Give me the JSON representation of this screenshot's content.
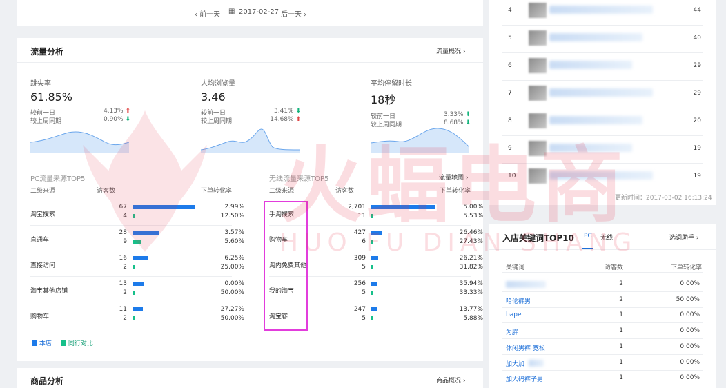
{
  "date_nav": {
    "prev": "前一天",
    "date": "2017-02-27",
    "next": "后一天"
  },
  "traffic": {
    "title": "流量分析",
    "overview_link": "流量概况",
    "metrics": [
      {
        "label": "跳失率",
        "value": "61.85%",
        "row1_label": "较前一日",
        "row1_val": "4.13%",
        "row1_dir": "up",
        "row2_label": "较上周同期",
        "row2_val": "0.90%",
        "row2_dir": "down"
      },
      {
        "label": "人均浏览量",
        "value": "3.46",
        "row1_label": "较前一日",
        "row1_val": "3.41%",
        "row1_dir": "down",
        "row2_label": "较上周同期",
        "row2_val": "14.68%",
        "row2_dir": "up"
      },
      {
        "label": "平均停留时长",
        "value": "18秒",
        "row1_label": "较前一日",
        "row1_val": "3.33%",
        "row1_dir": "down",
        "row2_label": "较上周同期",
        "row2_val": "8.68%",
        "row2_dir": "down"
      }
    ],
    "pc": {
      "title": "PC流量来源TOP5",
      "headers": [
        "二级来源",
        "访客数",
        "下单转化率"
      ],
      "rows": [
        {
          "name": "淘宝搜索",
          "v1": "67",
          "v2": "4",
          "r1": "2.99%",
          "r2": "12.50%",
          "f1": 0.98,
          "f2": 0.02
        },
        {
          "name": "直通车",
          "v1": "28",
          "v2": "9",
          "r1": "3.57%",
          "r2": "5.60%",
          "f1": 0.42,
          "f2": 0.13
        },
        {
          "name": "直接访问",
          "v1": "16",
          "v2": "2",
          "r1": "6.25%",
          "r2": "25.00%",
          "f1": 0.24,
          "f2": 0.03
        },
        {
          "name": "淘宝其他店铺",
          "v1": "13",
          "v2": "2",
          "r1": "0.00%",
          "r2": "50.00%",
          "f1": 0.19,
          "f2": 0.03
        },
        {
          "name": "购物车",
          "v1": "11",
          "v2": "2",
          "r1": "27.27%",
          "r2": "50.00%",
          "f1": 0.16,
          "f2": 0.03
        }
      ]
    },
    "mobile": {
      "title": "无线流量来源TOP5",
      "map_link": "流量地图",
      "headers": [
        "二级来源",
        "访客数",
        "下单转化率"
      ],
      "rows": [
        {
          "name": "手淘搜索",
          "v1": "2,701",
          "v2": "11",
          "r1": "5.00%",
          "r2": "5.53%",
          "f1": 1.0,
          "f2": 0.03
        },
        {
          "name": "购物车",
          "v1": "427",
          "v2": "6",
          "r1": "26.46%",
          "r2": "27.43%",
          "f1": 0.16,
          "f2": 0.03
        },
        {
          "name": "淘内免费其他",
          "v1": "309",
          "v2": "5",
          "r1": "26.21%",
          "r2": "31.82%",
          "f1": 0.11,
          "f2": 0.03
        },
        {
          "name": "我的淘宝",
          "v1": "256",
          "v2": "5",
          "r1": "35.94%",
          "r2": "33.33%",
          "f1": 0.09,
          "f2": 0.03
        },
        {
          "name": "淘宝客",
          "v1": "247",
          "v2": "5",
          "r1": "13.77%",
          "r2": "5.88%",
          "f1": 0.09,
          "f2": 0.03
        }
      ]
    },
    "legend": {
      "own": "本店",
      "peer": "同行对比"
    }
  },
  "product": {
    "title": "商品分析",
    "overview_link": "商品概况"
  },
  "ranking": {
    "rows": [
      {
        "rank": "4",
        "value": "44"
      },
      {
        "rank": "5",
        "value": "40"
      },
      {
        "rank": "6",
        "value": "29"
      },
      {
        "rank": "7",
        "value": "29"
      },
      {
        "rank": "8",
        "value": "20"
      },
      {
        "rank": "9",
        "value": "19"
      },
      {
        "rank": "10",
        "value": "19"
      }
    ],
    "updated": "更新时间：2017-03-02 16:13:24"
  },
  "keywords": {
    "title": "入店关键词TOP10",
    "tabs": [
      "PC",
      "无线"
    ],
    "helper_link": "选词助手",
    "headers": [
      "关键词",
      "访客数",
      "下单转化率"
    ],
    "rows": [
      {
        "word": "",
        "visitors": "2",
        "rate": "0.00%"
      },
      {
        "word": "哈伦裤男",
        "visitors": "2",
        "rate": "50.00%"
      },
      {
        "word": "bape",
        "visitors": "1",
        "rate": "0.00%"
      },
      {
        "word": "为胖",
        "visitors": "1",
        "rate": "0.00%"
      },
      {
        "word": "休闲男裤 宽松",
        "visitors": "1",
        "rate": "0.00%"
      },
      {
        "word": "加大加",
        "visitors": "1",
        "rate": "0.00%"
      },
      {
        "word": "加大码裤子男",
        "visitors": "1",
        "rate": "0.00%"
      }
    ]
  },
  "watermark": {
    "cn": "火蝠电商",
    "en": "HUO FU DIAN SHANG"
  },
  "colors": {
    "accent": "#1d7bea",
    "peer": "#16c08a",
    "up": "#e04545",
    "down": "#15b47c",
    "highlight": "#e23ddc",
    "watermark": "#e8314a"
  }
}
